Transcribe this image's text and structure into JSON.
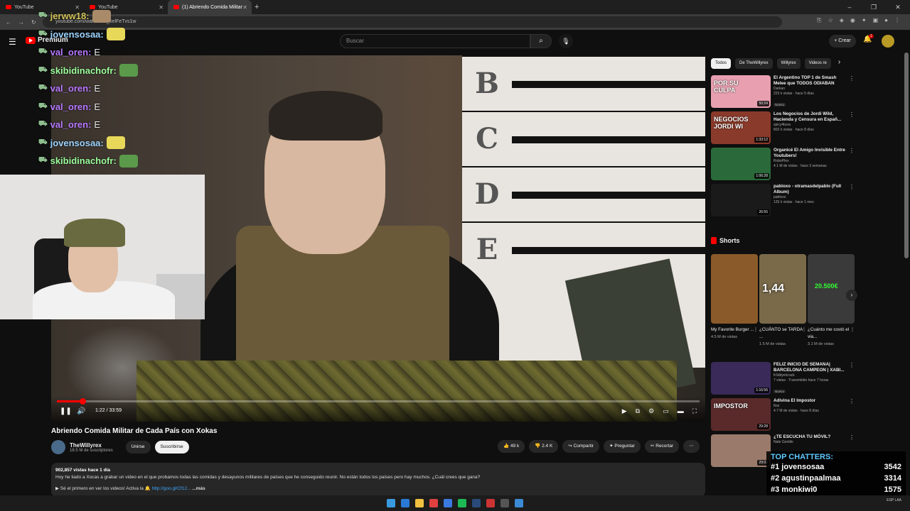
{
  "browser": {
    "tabs": [
      {
        "label": "YouTube",
        "active": false
      },
      {
        "label": "YouTube",
        "active": false
      },
      {
        "label": "(1) Abriendo Comida Militar",
        "active": true
      }
    ],
    "new_tab": "+",
    "url": "youtube.com/watch?v=_oelFeTvs1w",
    "window_controls": [
      "–",
      "❐",
      "✕"
    ]
  },
  "header": {
    "logo": "Premium",
    "search_placeholder": "Buscar",
    "create_label": "+ Crear",
    "notif_count": "1"
  },
  "video": {
    "board_letters": [
      "B",
      "C",
      "D",
      "E"
    ],
    "time": "1:22 / 33:59",
    "progress": 0.04,
    "title": "Abriendo Comida Militar de Cada País con Xokas"
  },
  "stream_chat": [
    {
      "user": "jerww18:",
      "color": "#d3c35a",
      "text": "",
      "emote": "#a98b6a"
    },
    {
      "user": "jovensosaa:",
      "color": "#9cd3ff",
      "text": "",
      "emote": "#e8d85a"
    },
    {
      "user": "val_oren:",
      "color": "#b779ff",
      "text": "E",
      "emote": ""
    },
    {
      "user": "skibidinachofr:",
      "color": "#9cff9c",
      "text": "",
      "emote": "#5a9a4a"
    },
    {
      "user": "val_oren:",
      "color": "#b779ff",
      "text": "E",
      "emote": ""
    },
    {
      "user": "val_oren:",
      "color": "#b779ff",
      "text": "E",
      "emote": ""
    },
    {
      "user": "val_oren:",
      "color": "#b779ff",
      "text": "E",
      "emote": ""
    },
    {
      "user": "jovensosaa:",
      "color": "#9cd3ff",
      "text": "",
      "emote": "#e8d85a"
    },
    {
      "user": "skibidinachofr:",
      "color": "#9cff9c",
      "text": "",
      "emote": "#5a9a4a"
    }
  ],
  "channel": {
    "name": "TheWillyrex",
    "subs": "18.5 M de suscriptores",
    "join": "Unirse",
    "subscribe": "Suscribirse"
  },
  "actions": {
    "likes": "49 k",
    "dislikes": "2.4 K",
    "share": "Compartir",
    "ask": "Preguntar",
    "clip": "Recortar"
  },
  "description": {
    "stats": "902,857 vistas  hace 1 día",
    "text": "Hoy he liado a Xocas a grabar un video en el que probamos todas las comidas y desayunos militares de países que he conseguido reunir. No están todos los países pero hay muchos. ¿Cuál crees que gana?",
    "line2": "▶ Sé el primero en ver los videos! Activa la 🔔",
    "link": "http://goo.gl/Cf12...",
    "more": "...más"
  },
  "chips": [
    "Todos",
    "De TheWillyrex",
    "Willyrex",
    "Videos re"
  ],
  "recommendations": [
    {
      "title": "El Argentino TOP 1 de Smash Melee que TODOS ODIABAN",
      "channel": "Darkan",
      "meta": "223 k vistas · hace 5 días",
      "badge": "Nuevo",
      "duration": "50:24",
      "thumb": "#e8a0b0",
      "overlay": "POR SU CULPA"
    },
    {
      "title": "Los Negocios de Jordi Wild, Hacienda y Censura en Españ...",
      "channel": "spicy4tuna",
      "meta": "802 k vistas · hace 8 días",
      "badge": "",
      "duration": "1:33:12",
      "thumb": "#8a3a2a",
      "overlay": "NEGOCIOS JORDI WI"
    },
    {
      "title": "Organicé El Amigo Invisible Entre Youtubers!",
      "channel": "RoboPlex",
      "meta": "4.1 M de vistas · hace 3 semanas",
      "badge": "",
      "duration": "1:06:28",
      "thumb": "#2a6a3a",
      "overlay": ""
    },
    {
      "title": "pabloxo - otramasdelpablo (Full Album)",
      "channel": "pabloxo",
      "meta": "126 k vistas · hace 1 mes",
      "badge": "",
      "duration": "26:55",
      "thumb": "#1a1a1a",
      "overlay": ""
    }
  ],
  "shorts": {
    "heading": "Shorts",
    "items": [
      {
        "title": "My Favorite Burger ...",
        "views": "4.5 M de vistas",
        "thumb": "#8a5a2a",
        "big": "",
        "green": ""
      },
      {
        "title": "¿CUÁNTO se TARDA ...",
        "views": "1.5 M de vistas",
        "thumb": "#7a6a4a",
        "big": "1,44",
        "green": ""
      },
      {
        "title": "¿Cuánto me costó el via...",
        "views": "3.1 M de vistas",
        "thumb": "#3a3a3a",
        "big": "",
        "green": "20.500€"
      }
    ]
  },
  "recommendations2": [
    {
      "title": "FELIZ INICIO DE SEMANA| BARCELONA CAMPEON | XABI...",
      "channel": "fr3ddyelcrack",
      "meta": "7 vistas · Transmitido hace 7 horas",
      "badge": "Nuevo",
      "duration": "1:16:56",
      "thumb": "#3a2a5a",
      "overlay": ""
    },
    {
      "title": "Adivina El Impostor",
      "channel": "Ibai",
      "meta": "4.7 M de vistas · hace 8 días",
      "badge": "",
      "duration": "29:28",
      "thumb": "#5a2a2a",
      "overlay": "IMPOSTOR"
    },
    {
      "title": "¿TE ESCUCHA TU MÓVIL?",
      "channel": "Nate Gentile",
      "meta": "",
      "badge": "",
      "duration": "29:03",
      "thumb": "#9a7a6a",
      "overlay": ""
    }
  ],
  "top_chatters": {
    "heading": "TOP CHATTERS:",
    "rows": [
      {
        "rank": "#1",
        "name": "jovensosaa",
        "count": "3542"
      },
      {
        "rank": "#2",
        "name": "agustinpaalmaa",
        "count": "3314"
      },
      {
        "rank": "#3",
        "name": "monkiwi0",
        "count": "1575"
      }
    ]
  },
  "taskbar": {
    "apps": [
      "#2a7ad5",
      "#f0c040",
      "#e04040",
      "#3a7ae0",
      "#1db954",
      "#2a4a7a",
      "#cc3333",
      "#555555",
      "#3a8ad5"
    ],
    "lang": "ESP LAA"
  },
  "colors": {
    "accent": "#ff0000",
    "link": "#3ea6ff"
  }
}
